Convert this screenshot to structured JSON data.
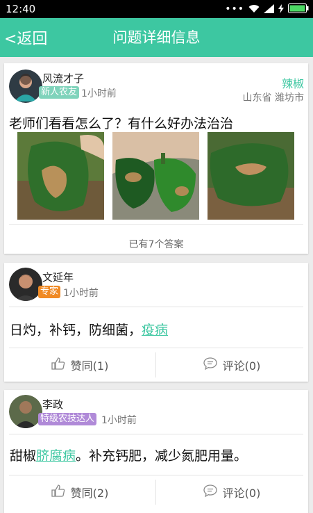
{
  "status": {
    "time": "12:40"
  },
  "header": {
    "back_label": "<返回",
    "title": "问题详细信息"
  },
  "question": {
    "user": "风流才子",
    "badge": "新人农友",
    "time": "1小时前",
    "crop": "辣椒",
    "location": "山东省 潍坊市",
    "text": "老师们看看怎么了？有什么好办法治治",
    "answers_count_label": "已有7个答案"
  },
  "answers": [
    {
      "user": "文延年",
      "badge": "专家",
      "time": "1小时前",
      "text_parts": [
        "日灼，补钙，防细菌，",
        "疫病",
        ""
      ],
      "like_label": "赞同(1)",
      "comment_label": "评论(0)"
    },
    {
      "user": "李政",
      "badge": "特级农技达人",
      "time": "1小时前",
      "text_parts": [
        "甜椒",
        "脐腐病",
        "。补充钙肥，减少氮肥用量。"
      ],
      "like_label": "赞同(2)",
      "comment_label": "评论(0)"
    }
  ],
  "icons": {
    "back": "back-icon",
    "like": "thumbs-up-icon",
    "comment": "comment-icon",
    "wifi": "wifi-icon",
    "signal": "signal-icon",
    "battery": "battery-icon"
  },
  "colors": {
    "accent": "#3dc7a1",
    "badge_new": "#7fd3bb",
    "badge_expert": "#f08a24",
    "badge_master": "#b08ad8"
  }
}
